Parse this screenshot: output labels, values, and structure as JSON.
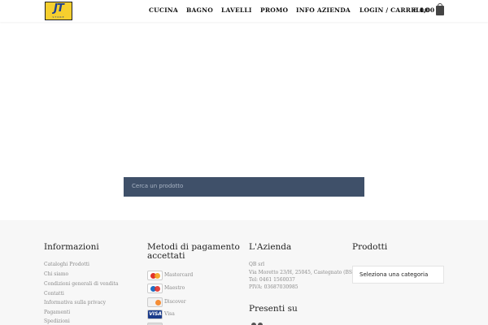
{
  "logo": {
    "text": "JT",
    "subtext": "STORE"
  },
  "nav": {
    "items": [
      {
        "label": "CUCINA"
      },
      {
        "label": "BAGNO"
      },
      {
        "label": "LAVELLI"
      },
      {
        "label": "PROMO"
      },
      {
        "label": "INFO AZIENDA"
      }
    ],
    "caret": "⌄",
    "login": "LOGIN / CARRELLO",
    "cart_total": "€ 0,00"
  },
  "search": {
    "placeholder": "Cerca un prodotto"
  },
  "footer": {
    "informazioni": {
      "title": "Informazioni",
      "links": [
        "Cataloghi Prodotti",
        "Chi siamo",
        "Condizioni generali di vendita",
        "Contatti",
        "Informativa sulla privacy",
        "Pagamenti",
        "Spedizioni"
      ]
    },
    "pagamento": {
      "title_line1": "Metodi di pagamento",
      "title_line2": "accettati",
      "methods": [
        {
          "label": "Mastercard",
          "icon": "mastercard-icon"
        },
        {
          "label": "Maestro",
          "icon": "maestro-icon"
        },
        {
          "label": "Discover",
          "icon": "discover-icon"
        },
        {
          "label": "Visa",
          "icon": "visa-icon",
          "text": "VISA"
        }
      ]
    },
    "azienda": {
      "title": "L'Azienda",
      "lines": [
        "QB srl",
        "Via Moretto 23/H, 25045, Castegnato (BS)",
        "Tel: 0461 1560037",
        "PIVA: 03687030985"
      ],
      "presenti_title": "Presenti su"
    },
    "prodotti": {
      "title": "Prodotti",
      "select_value": "Seleziona una categoria"
    }
  }
}
